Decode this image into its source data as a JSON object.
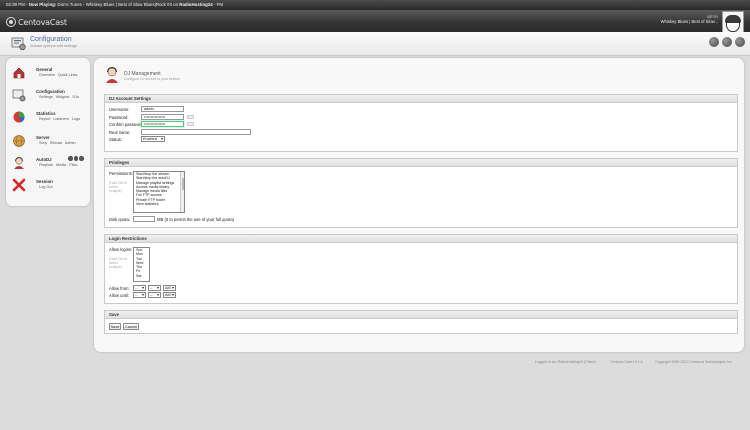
{
  "now_playing": {
    "time": "02:39 PM",
    "label": "Now Playing:",
    "track": "Don's Tunes - Whiskey Blues | Best of Slow Blues|Rock #3",
    "station_prefix": "on",
    "station": "RadioHosting24",
    "suffix": "- FM"
  },
  "header": {
    "logo_text": "CentovaCast",
    "user_name": "admin",
    "user_line": "Whiskey Blues | Best of Slow...",
    "icon_names": [
      "help-icon",
      "server-icon",
      "logout-icon"
    ]
  },
  "subheader": {
    "title": "Configuration",
    "description": "Stream options and settings"
  },
  "sidebar": {
    "groups": [
      {
        "title": "General",
        "icon": "house-icon",
        "links": [
          "Overview",
          "Quick Links"
        ]
      },
      {
        "title": "Configuration",
        "icon": "config-icon",
        "links": [
          "Settings",
          "Widgets",
          "DJs"
        ]
      },
      {
        "title": "Statistics",
        "icon": "pie-chart-icon",
        "links": [
          "Report",
          "Listeners",
          "Logs"
        ]
      },
      {
        "title": "Server",
        "icon": "globe-icon",
        "links": [
          "Stop",
          "Reload",
          "Admin"
        ]
      },
      {
        "title": "AutoDJ",
        "icon": "dj-icon",
        "links": [
          "Playlists",
          "Media",
          "Files"
        ]
      },
      {
        "title": "Session",
        "icon": "close-x-icon",
        "links": [
          "Log Out"
        ]
      }
    ]
  },
  "page": {
    "title": "DJ Management",
    "description": "Configure DJ access to your stream"
  },
  "account": {
    "heading": "DJ Account Settings",
    "username_label": "Username:",
    "username_value": "admin",
    "password_label": "Password:",
    "password_value": "••••••••••••••••",
    "confirm_label": "Confirm password:",
    "confirm_value": "••••••••••••••••",
    "realname_label": "Real name:",
    "realname_value": "",
    "status_label": "Status:",
    "status_value": "Enabled"
  },
  "privileges": {
    "heading": "Privileges",
    "permissions_label": "Permissions:",
    "permissions_hint": "(Hold Ctrl to select multiple)",
    "permissions": [
      "Start/stop the stream",
      "Start/stop the autoDJ",
      "Manage playlist settings",
      "Access media library",
      "Manage media files",
      "Full FTP access",
      "Private FTP folder",
      "View statistics"
    ],
    "quota_label": "Disk quota:",
    "quota_value": "",
    "quota_unit": "MB (0 to permit the use of your full quota)"
  },
  "login": {
    "heading": "Login Restrictions",
    "days_label": "Allow logins:",
    "days_hint": "(Hold Ctrl to select multiple)",
    "days": [
      "Sun",
      "Mon",
      "Tue",
      "Wed",
      "Thu",
      "Fri",
      "Sat"
    ],
    "from_label": "Allow from:",
    "until_label": "Allow until:",
    "hour_value": "--",
    "minute_value": "--",
    "ampm_value": "AM"
  },
  "save": {
    "heading": "Save",
    "save_label": "Save",
    "cancel_label": "Cancel"
  },
  "footer": {
    "logged_in": "Logged in as: RadioHosting24 (Client)",
    "version": "Centova Cast v3.1.0",
    "copyright": "Copyright 2005-2013, Centova Technologies Inc."
  }
}
